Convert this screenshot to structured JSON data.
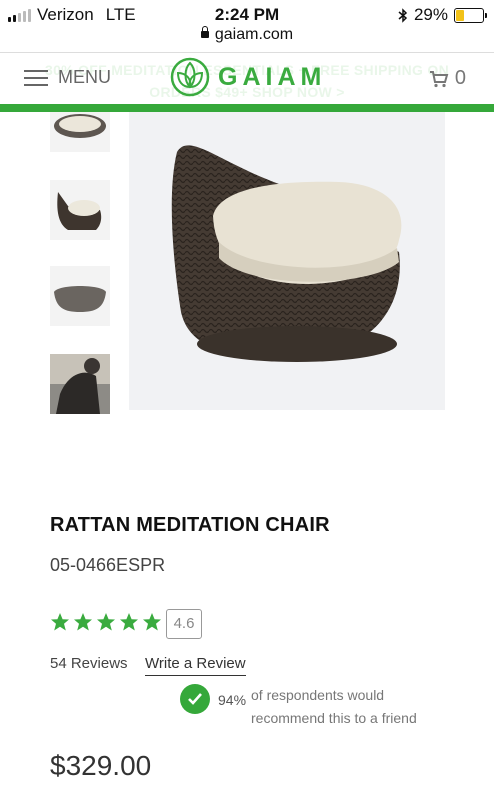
{
  "status_bar": {
    "carrier": "Verizon",
    "network": "LTE",
    "time": "2:24 PM",
    "battery": "29%",
    "battery_level": 0.29
  },
  "browser": {
    "url": "gaiam.com"
  },
  "header": {
    "menu_label": "MENU",
    "logo_text": "GAIAM",
    "cart_count": "0",
    "banner_line1": "30% OFF MEDITATION ESSENTIALS + FREE SHIPPING ON",
    "banner_line2": "ORDERS $49+ SHOP NOW >"
  },
  "colors": {
    "brand_green": "#35a83a",
    "star_green": "#3aab3f"
  },
  "product": {
    "title": "RATTAN MEDITATION CHAIR",
    "sku": "05-0466ESPR",
    "rating": "4.6",
    "stars": 5,
    "reviews_count": "54 Reviews",
    "write_review": "Write a Review",
    "recommend_pct": "94%",
    "recommend_text": "of respondents would recommend this to a friend",
    "price": "$329.00"
  }
}
